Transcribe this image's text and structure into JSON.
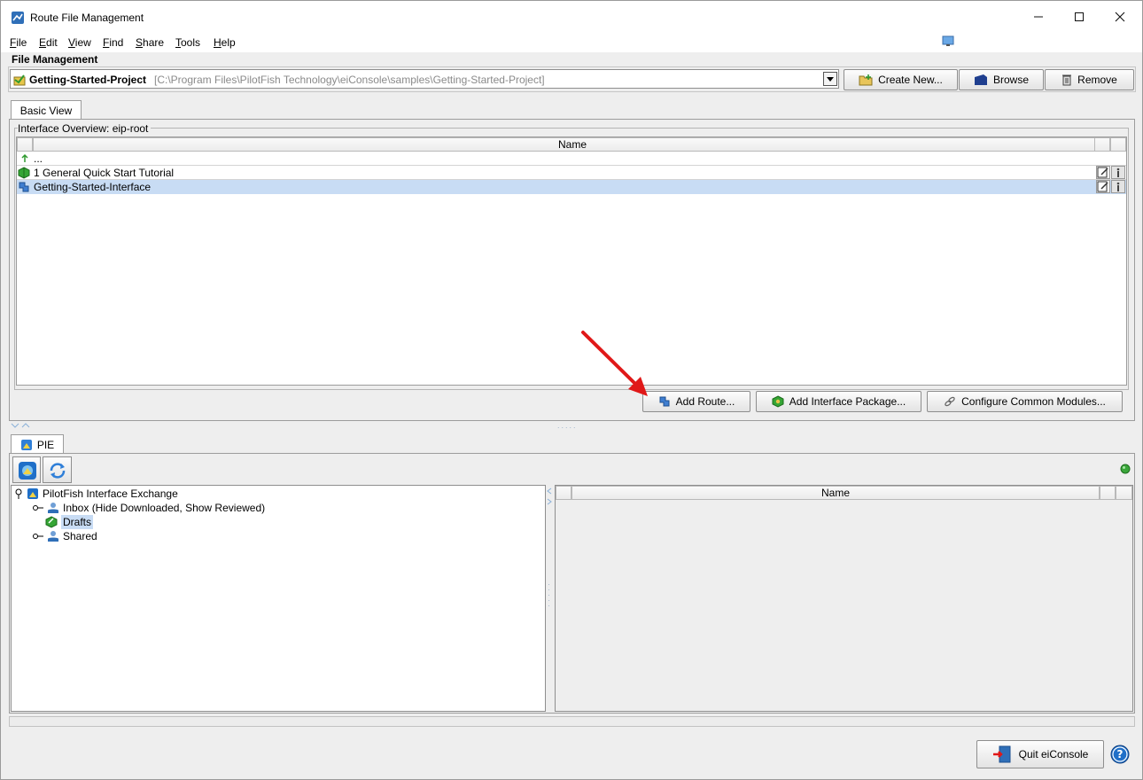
{
  "window": {
    "title": "Route File Management"
  },
  "menu": [
    {
      "mnemonic": "F",
      "rest": "ile"
    },
    {
      "mnemonic": "E",
      "rest": "dit"
    },
    {
      "mnemonic": "V",
      "rest": "iew"
    },
    {
      "mnemonic": "F",
      "rest": "ind"
    },
    {
      "mnemonic": "S",
      "rest": "hare"
    },
    {
      "mnemonic": "T",
      "rest": "ools"
    },
    {
      "mnemonic": "H",
      "rest": "elp"
    }
  ],
  "file_management": {
    "section_label": "File Management",
    "project_name": "Getting-Started-Project",
    "project_path": "[C:\\Program Files\\PilotFish Technology\\eiConsole\\samples\\Getting-Started-Project]",
    "create_new_label": "Create New...",
    "browse_label": "Browse",
    "remove_label": "Remove"
  },
  "basic_view": {
    "tab_label": "Basic View",
    "overview_label": "Interface Overview: eip-root",
    "column_name": "Name",
    "rows": [
      {
        "label": "..."
      },
      {
        "label": "1 General Quick Start Tutorial"
      },
      {
        "label": "Getting-Started-Interface"
      }
    ],
    "add_route_label": "Add Route...",
    "add_interface_package_label": "Add Interface Package...",
    "configure_common_modules_label": "Configure Common Modules..."
  },
  "pie": {
    "tab_label": "PIE",
    "tree": {
      "root": "PilotFish Interface Exchange",
      "children": [
        {
          "label": "Inbox (Hide Downloaded, Show Reviewed)"
        },
        {
          "label": "Drafts"
        },
        {
          "label": "Shared"
        }
      ]
    },
    "column_name": "Name",
    "status_color": "#3aa63a"
  },
  "footer": {
    "quit_label": "Quit eiConsole"
  },
  "colors": {
    "selection": "#c8dcf4",
    "arrow": "#e01818"
  }
}
